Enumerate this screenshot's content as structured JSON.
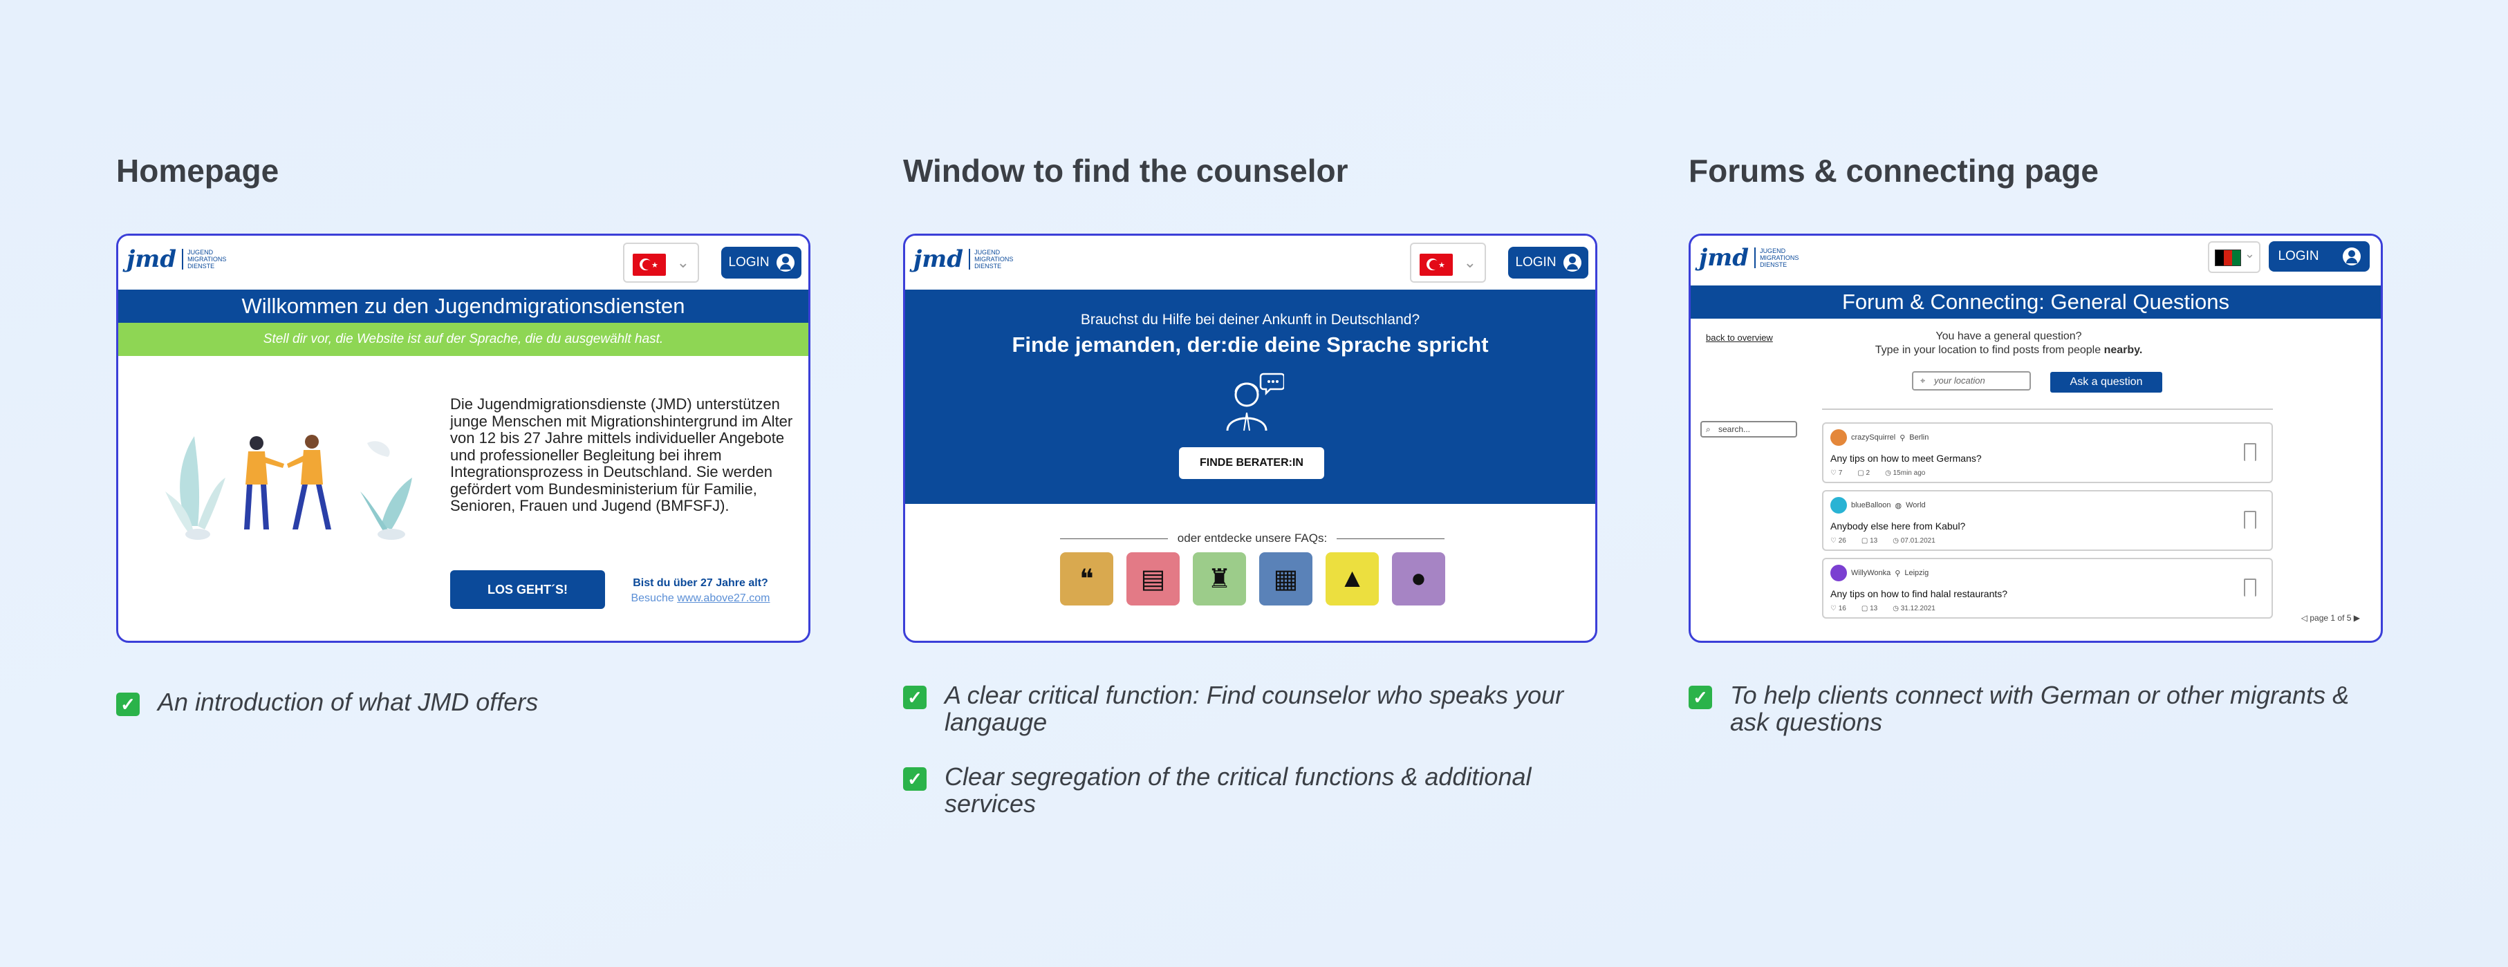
{
  "columns": [
    {
      "title": "Homepage",
      "bullets": [
        "An introduction of what JMD offers"
      ],
      "card": {
        "logo_mark": "jmd",
        "logo_text": [
          "JUGEND",
          "MIGRATIONS",
          "DIENSTE"
        ],
        "login_label": "LOGIN",
        "welcome": "Willkommen zu den Jugendmigrationsdiensten",
        "subline": "Stell dir vor, die Website ist auf der Sprache, die du ausgewählt hast.",
        "intro": "Die Jugendmigrationsdienste (JMD) unterstützen junge Menschen mit Migrationshintergrund im Alter von 12 bis 27 Jahre mittels individueller Angebote und professioneller Begleitung bei ihrem Integrationsprozess in Deutschland. Sie werden gefördert vom Bundesministerium für Familie, Senioren, Frauen und Jugend (BMFSFJ).",
        "cta": "LOS GEHT´S!",
        "age_question": "Bist du über 27 Jahre alt?",
        "age_visit": "Besuche",
        "age_link": "www.above27.com"
      }
    },
    {
      "title": "Window to find the counselor",
      "bullets": [
        "A clear critical function: Find counselor who speaks your langauge",
        "Clear segregation of the critical functions & additional services"
      ],
      "card": {
        "login_label": "LOGIN",
        "help_question": "Brauchst du Hilfe bei deiner Ankunft in Deutschland?",
        "headline": "Finde jemanden, der:die deine Sprache spricht",
        "cta": "FINDE BERATER:IN",
        "faq_label": "oder entdecke unsere FAQs:",
        "faq_icons": [
          {
            "icon": "language-icon",
            "color": "#d9a94f"
          },
          {
            "icon": "passport-icon",
            "color": "#e37a86"
          },
          {
            "icon": "job-icon",
            "color": "#9ccc8a"
          },
          {
            "icon": "housing-icon",
            "color": "#5a82b8"
          },
          {
            "icon": "education-icon",
            "color": "#ecdf3f"
          },
          {
            "icon": "community-icon",
            "color": "#a684c4"
          }
        ]
      }
    },
    {
      "title": "Forums & connecting page",
      "bullets": [
        "To help clients connect with German or other migrants & ask questions"
      ],
      "card": {
        "login_label": "LOGIN",
        "banner": "Forum & Connecting: General Questions",
        "back_link": "back to overview",
        "q_line1": "You have a general question?",
        "q_line2": "Type in your location to find posts from people",
        "q_bold": "nearby.",
        "location_placeholder": "your location",
        "ask_button": "Ask a question",
        "search_placeholder": "search...",
        "posts": [
          {
            "user": "crazySquirrel",
            "location": "Berlin",
            "title": "Any tips on how to meet Germans?",
            "likes": "7",
            "comments": "2",
            "time": "15min ago",
            "avatar": "#e4873a"
          },
          {
            "user": "blueBalloon",
            "location": "World",
            "title": "Anybody else here from Kabul?",
            "likes": "26",
            "comments": "13",
            "time": "07.01.2021",
            "avatar": "#29b3d4"
          },
          {
            "user": "WillyWonka",
            "location": "Leipzig",
            "title": "Any tips on how to find halal restaurants?",
            "likes": "16",
            "comments": "13",
            "time": "31.12.2021",
            "avatar": "#7b3fd1"
          }
        ],
        "pagination": "page 1 of 5"
      }
    }
  ],
  "colors": {
    "brand_blue": "#0b4a9a",
    "green": "#8ed654",
    "card_border": "#3b3fd8"
  }
}
